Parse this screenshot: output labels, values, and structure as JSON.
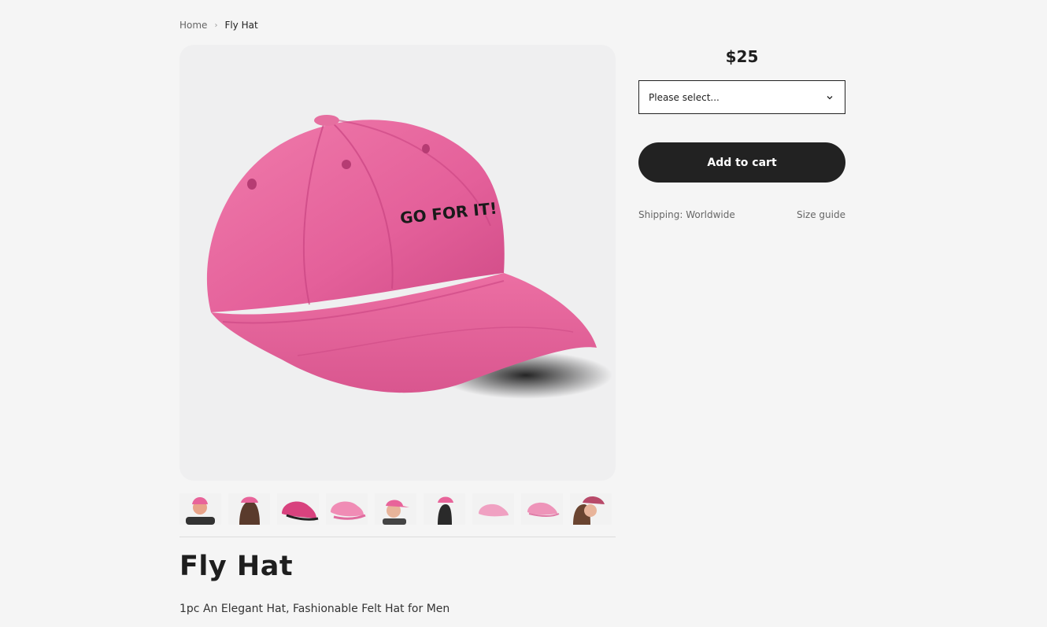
{
  "breadcrumb": {
    "home": "Home",
    "separator": "›",
    "current": "Fly Hat"
  },
  "product": {
    "title": "Fly Hat",
    "description": "1pc An Elegant Hat, Fashionable Felt Hat for Men",
    "price": "$25",
    "main_image_caption": "GO FOR IT!"
  },
  "variant": {
    "placeholder": "Please select...",
    "icon": "chevron-down-icon"
  },
  "actions": {
    "add_to_cart": "Add to cart"
  },
  "info": {
    "shipping": "Shipping: Worldwide",
    "size_guide": "Size guide"
  },
  "thumbnails": [
    {
      "name": "thumb-back-view-person"
    },
    {
      "name": "thumb-side-view-person"
    },
    {
      "name": "thumb-pink-cap-dark"
    },
    {
      "name": "thumb-pink-cap-light"
    },
    {
      "name": "thumb-man-side-view"
    },
    {
      "name": "thumb-woman-back-view"
    },
    {
      "name": "thumb-cap-flat-1"
    },
    {
      "name": "thumb-cap-flat-2"
    },
    {
      "name": "thumb-woman-dark-cap"
    }
  ],
  "colors": {
    "background": "#f5f5f5",
    "cap_pink": "#e8649a",
    "button": "#222222"
  }
}
